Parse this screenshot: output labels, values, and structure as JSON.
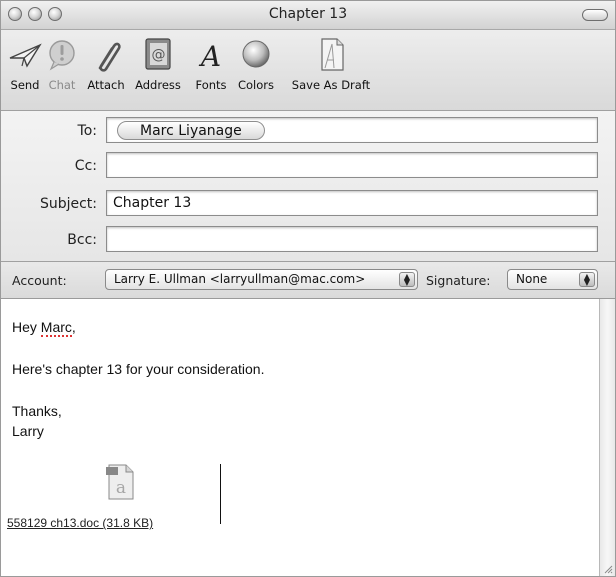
{
  "window": {
    "title": "Chapter 13"
  },
  "toolbar": {
    "items": [
      {
        "label": "Send",
        "icon": "send-icon"
      },
      {
        "label": "Chat",
        "icon": "chat-icon",
        "disabled": true
      },
      {
        "label": "Attach",
        "icon": "paperclip-icon"
      },
      {
        "label": "Address",
        "icon": "address-book-icon"
      },
      {
        "label": "Fonts",
        "icon": "fonts-icon"
      },
      {
        "label": "Colors",
        "icon": "colors-icon"
      },
      {
        "label": "Save As Draft",
        "icon": "draft-icon"
      }
    ]
  },
  "headers": {
    "to_label": "To:",
    "to_recipient": "Marc Liyanage",
    "cc_label": "Cc:",
    "cc_value": "",
    "subject_label": "Subject:",
    "subject_value": "Chapter 13",
    "bcc_label": "Bcc:",
    "bcc_value": ""
  },
  "account": {
    "account_label": "Account:",
    "account_value": "Larry E. Ullman <larryullman@mac.com>",
    "signature_label": "Signature:",
    "signature_value": "None"
  },
  "body": {
    "greeting_prefix": "Hey ",
    "greeting_name": "Marc",
    "greeting_suffix": ",",
    "line1": "Here's chapter 13 for your consideration.",
    "closing": "Thanks,",
    "signoff": "Larry",
    "attachment": "558129 ch13.doc (31.8 KB)"
  },
  "colors": {
    "chrome": "#e3e3e3",
    "field_border": "#8c8c8c",
    "misspelling": "#dd3333"
  }
}
